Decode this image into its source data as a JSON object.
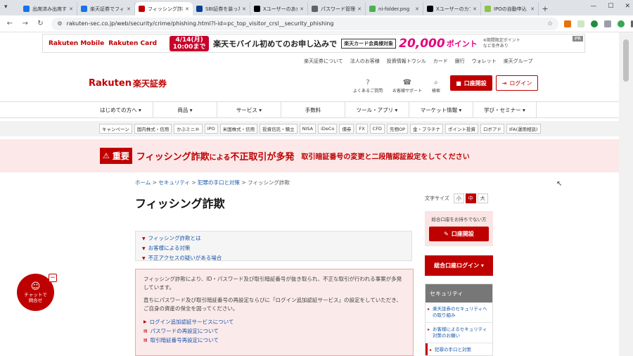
{
  "browser": {
    "tabs": [
      {
        "title": "出席済み出席する",
        "color": "#1a73e8"
      },
      {
        "title": "楽天証券でフィッ",
        "color": "#1a73e8"
      },
      {
        "title": "フィッシング詐欺",
        "color": "#bf0000",
        "active": true
      },
      {
        "title": "SBI証券を装った",
        "color": "#0b3d91"
      },
      {
        "title": "Xユーザーのあか",
        "color": "#000000"
      },
      {
        "title": "パスワード管理ソ",
        "color": "#5f6368"
      },
      {
        "title": "ni-folder.png",
        "color": "#4caf50"
      },
      {
        "title": "Xユーザーのカブ",
        "color": "#000000"
      },
      {
        "title": "IPOの自動申込",
        "color": "#8bc34a"
      }
    ],
    "new_tab": "+",
    "url": "rakuten-sec.co.jp/web/security/crime/phishing.html?l-id=pc_top_visitor_crsl__security_phishing"
  },
  "ad": {
    "brand1": "Rakuten Mobile",
    "brand2": "Rakuten Card",
    "date": "4/14(月)",
    "time": "10:00まで",
    "message": "楽天モバイル初めてのお申し込みで",
    "card_tag": "楽天カード会員様対象",
    "points": "20,000",
    "points_label": "ポイント",
    "note1": "※期間限定ポイント",
    "note2": "など条件あり",
    "pr": "PR"
  },
  "toplinks": [
    "楽天証券について",
    "法人のお客様",
    "投資情報トウシル",
    "カード",
    "銀行",
    "ウォレット",
    "楽天グループ"
  ],
  "logo": {
    "en": "Rakuten",
    "jp": "楽天証券"
  },
  "header_icons": [
    {
      "icon": "?",
      "label": "よくあるご質問"
    },
    {
      "icon": "☎",
      "label": "お客様サポート"
    },
    {
      "icon": "⌕",
      "label": "検索"
    }
  ],
  "header_buttons": {
    "open": "口座開設",
    "login": "ログイン"
  },
  "gnav": [
    "はじめての方へ ▾",
    "商品 ▾",
    "サービス ▾",
    "手数料",
    "ツール・アプリ ▾",
    "マーケット情報 ▾",
    "学び・セミナー ▾"
  ],
  "subnav": [
    "キャンペーン",
    "国内株式・信用",
    "かぶミニ®",
    "IPO",
    "米国株式・信用",
    "投資信託・積立",
    "NISA",
    "iDeCo",
    "債券",
    "FX",
    "CFD",
    "先物OP",
    "金・プラチナ",
    "ポイント投資",
    "ロボアド",
    "IFA(運用相談)"
  ],
  "alert": {
    "badge": "重要",
    "title_main": "フィッシング詐欺",
    "title_mid": "による",
    "title_end": "不正取引が多発",
    "sub": "取引暗証番号の変更と二段階認証設定をしてください"
  },
  "breadcrumb": {
    "items": [
      "ホーム",
      "セキュリティ",
      "犯罪の手口と対策"
    ],
    "current": "フィッシング詐欺",
    "sep": ">"
  },
  "page_title": "フィッシング詐欺",
  "toc": [
    "フィッシング詐欺とは",
    "お客様による対策",
    "不正アクセスの疑いがある場合"
  ],
  "notice": {
    "p1": "フィッシング詐欺により、ID・パスワード及び取引暗証番号が抜き取られ、不正な取引が行われる事案が多発しています。",
    "p2": "直ちにパスワード及び取引暗証番号の再設定ならびに「ログイン追加認証サービス」の設定をしていただき、ご自身の資産の保全を図ってください。",
    "links": [
      "ログイン追加認証サービスについて",
      "パスワードの再設定について",
      "取引暗証番号再設定について"
    ]
  },
  "font_size": {
    "label": "文字サイズ",
    "small": "小",
    "mid": "中",
    "large": "大"
  },
  "side_open": {
    "text": "総合口座をお持ちでない方",
    "button": "口座開設"
  },
  "side_login": "総合口座ログイン ▾",
  "side_menu": {
    "header": "セキュリティ",
    "items": [
      "楽天証券のセキュリティへの取り組み",
      "お客様によるセキュリティ対策のお願い",
      "犯罪の手口と対策"
    ]
  },
  "chat": {
    "line1": "チャットで",
    "line2": "問合せ",
    "minimize": "−"
  }
}
